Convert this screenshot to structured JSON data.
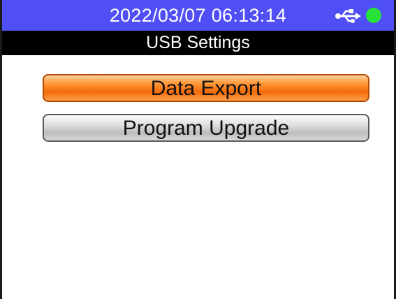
{
  "status_bar": {
    "datetime": "2022/03/07 06:13:14",
    "usb_icon": "usb-icon",
    "indicator_color": "#27e03a",
    "background_color": "#4f4ff5"
  },
  "title_bar": {
    "title": "USB Settings"
  },
  "menu": {
    "items": [
      {
        "label": "Data Export",
        "selected": true,
        "color": "#f46a08"
      },
      {
        "label": "Program Upgrade",
        "selected": false,
        "color": "#bdbdbd"
      }
    ]
  }
}
